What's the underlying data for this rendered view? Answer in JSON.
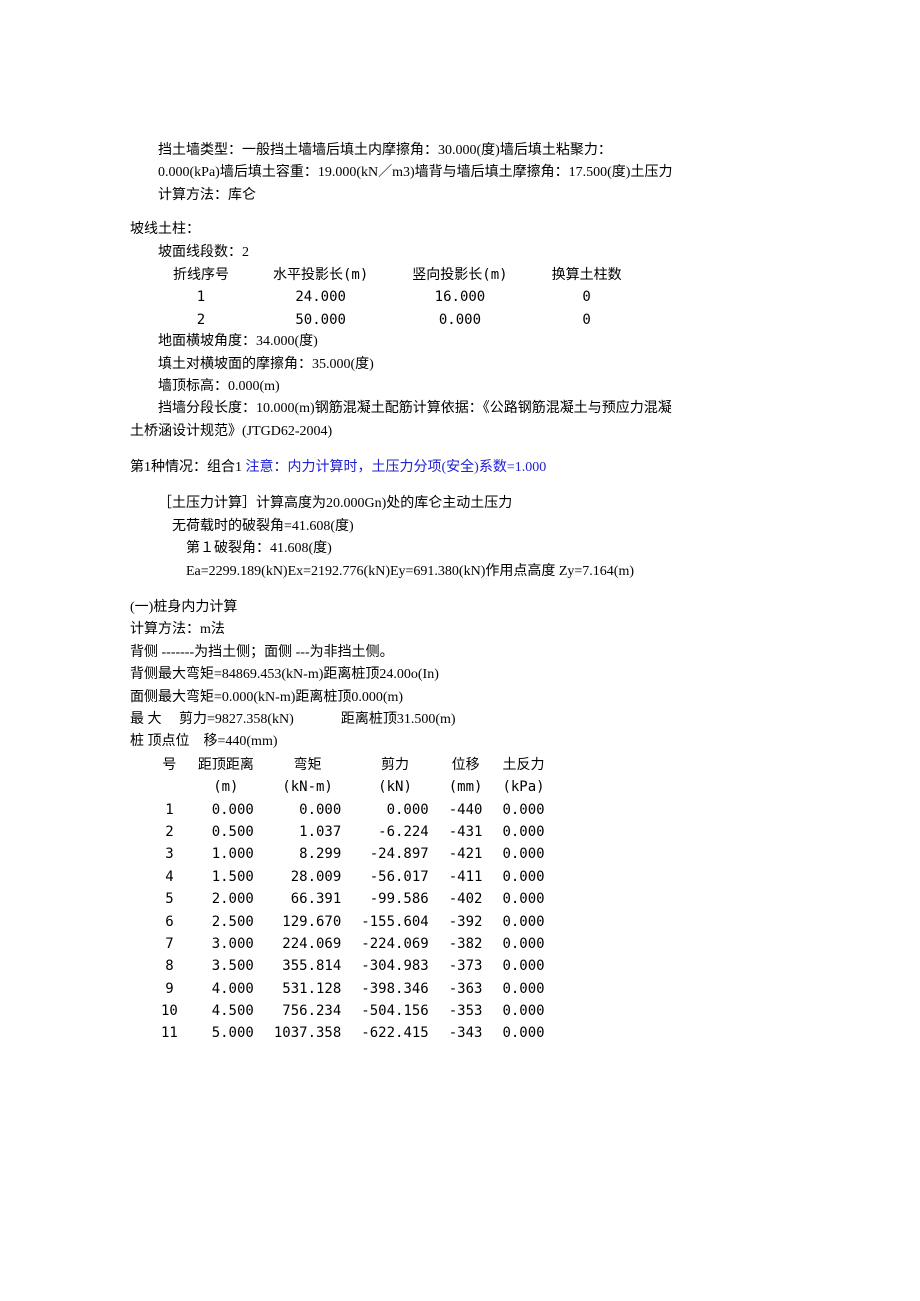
{
  "intro": {
    "l1": "挡土墙类型：一般挡土墙墙后填土内摩擦角：30.000(度)墙后填土粘聚力：",
    "l2": "0.000(kPa)墙后填土容重：19.000(kN／m3)墙背与墙后填土摩擦角：17.500(度)土压力",
    "l3": "计算方法：库仑"
  },
  "slopeHeader": "坡线土柱：",
  "slopeCount": "坡面线段数：2",
  "slopeTblHdr": {
    "c1": "折线序号",
    "c2": "水平投影长(m)",
    "c3": "竖向投影长(m)",
    "c4": "换算土柱数"
  },
  "slopeRows": [
    {
      "c1": "1",
      "c2": "24.000",
      "c3": "16.000",
      "c4": "0"
    },
    {
      "c1": "2",
      "c2": "50.000",
      "c3": "0.000",
      "c4": "0"
    }
  ],
  "slopeExtra": {
    "l1": "地面横坡角度：34.000(度)",
    "l2": "填土对横坡面的摩擦角：35.000(度)",
    "l3": "墙顶标高：0.000(m)",
    "l4": "挡墙分段长度：10.000(m)钢筋混凝土配筋计算依据：《公路钢筋混凝土与预应力混凝",
    "l5": "土桥涵设计规范》(JTGD62-2004)"
  },
  "case1": {
    "pfx": "第1种情况：组合1",
    "note": "注意：内力计算时，土压力分项(安全)系数=1.000"
  },
  "earthPressure": {
    "l1": "［土压力计算］计算高度为20.000Gn)处的库仑主动土压力",
    "l2": "无荷载时的破裂角=41.608(度)",
    "l3": "第１破裂角：41.608(度)",
    "l4": "Ea=2299.189(kN)Ex=2192.776(kN)Ey=691.380(kN)作用点高度 Zy=7.164(m)"
  },
  "calc": {
    "l1": "(一)桩身内力计算",
    "l2": "计算方法：m法",
    "l3": "背侧 -------为挡土侧；面侧 ---为非挡土侧。",
    "l4": "背侧最大弯矩=84869.453(kN-m)距离桩顶24.00o(In)",
    "l5": "面侧最大弯矩=0.000(kN-m)距离桩顶0.000(m)",
    "l6a": "最 大　 剪力=9827.358(kN)",
    "l6b": "距离桩顶31.500(m)",
    "l7": "桩 顶点位　移=440(mm)"
  },
  "resHdr": {
    "c1": "号",
    "c2a": "距顶距离",
    "c2b": "(m)",
    "c3a": "弯矩",
    "c3b": "(kN-m)",
    "c4a": "剪力",
    "c4b": "(kN)",
    "c5a": "位移",
    "c5b": "(mm)",
    "c6a": "土反力",
    "c6b": "(kPa)"
  },
  "resRows": [
    {
      "n": "1",
      "d": "0.000",
      "m": "0.000",
      "s": "0.000",
      "dp": "-440",
      "r": "0.000"
    },
    {
      "n": "2",
      "d": "0.500",
      "m": "1.037",
      "s": "-6.224",
      "dp": "-431",
      "r": "0.000"
    },
    {
      "n": "3",
      "d": "1.000",
      "m": "8.299",
      "s": "-24.897",
      "dp": "-421",
      "r": "0.000"
    },
    {
      "n": "4",
      "d": "1.500",
      "m": "28.009",
      "s": "-56.017",
      "dp": "-411",
      "r": "0.000"
    },
    {
      "n": "5",
      "d": "2.000",
      "m": "66.391",
      "s": "-99.586",
      "dp": "-402",
      "r": "0.000"
    },
    {
      "n": "6",
      "d": "2.500",
      "m": "129.670",
      "s": "-155.604",
      "dp": "-392",
      "r": "0.000"
    },
    {
      "n": "7",
      "d": "3.000",
      "m": "224.069",
      "s": "-224.069",
      "dp": "-382",
      "r": "0.000"
    },
    {
      "n": "8",
      "d": "3.500",
      "m": "355.814",
      "s": "-304.983",
      "dp": "-373",
      "r": "0.000"
    },
    {
      "n": "9",
      "d": "4.000",
      "m": "531.128",
      "s": "-398.346",
      "dp": "-363",
      "r": "0.000"
    },
    {
      "n": "10",
      "d": "4.500",
      "m": "756.234",
      "s": "-504.156",
      "dp": "-353",
      "r": "0.000"
    },
    {
      "n": "11",
      "d": "5.000",
      "m": "1037.358",
      "s": "-622.415",
      "dp": "-343",
      "r": "0.000"
    }
  ]
}
